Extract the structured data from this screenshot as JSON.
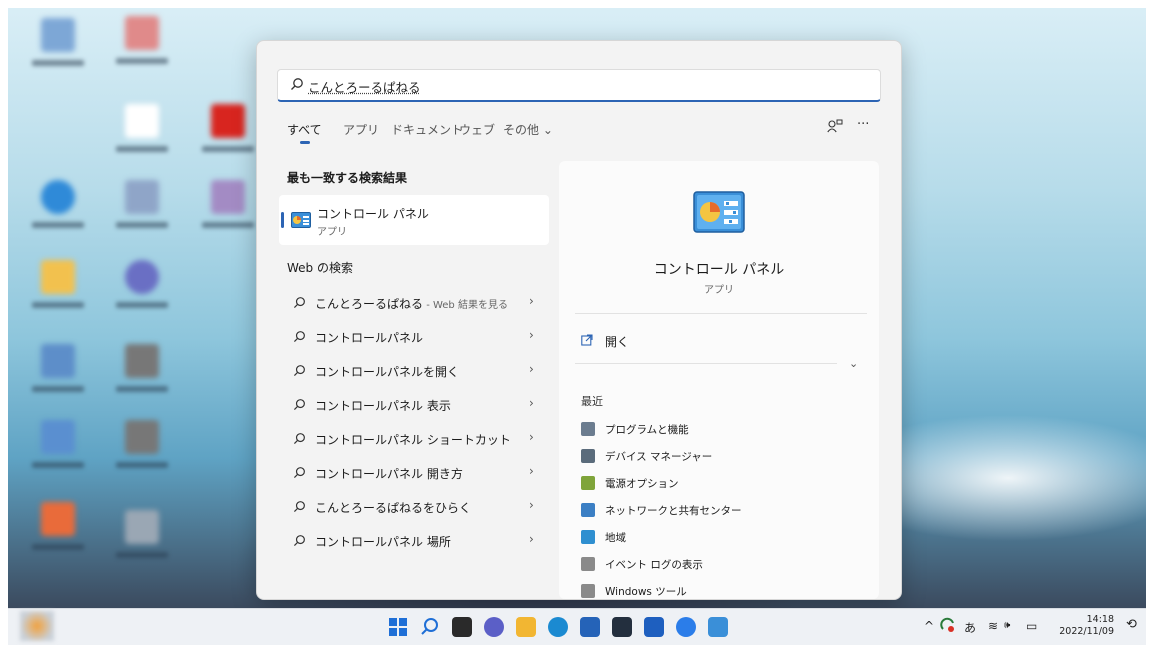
{
  "search": {
    "query": "こんとろーるぱねる"
  },
  "tabs": [
    {
      "label": "すべて"
    },
    {
      "label": "アプリ"
    },
    {
      "label": "ドキュメント"
    },
    {
      "label": "ウェブ"
    },
    {
      "label": "その他 ⌄"
    }
  ],
  "toolbar": {
    "account_icon": "account-icon",
    "more_label": "···"
  },
  "best_match": {
    "title": "最も一致する検索結果",
    "name": "コントロール パネル",
    "type": "アプリ"
  },
  "web": {
    "title": "Web の検索",
    "items": [
      {
        "text": "こんとろーるぱねる",
        "suffix": " - Web 結果を見る"
      },
      {
        "text": "コントロールパネル",
        "suffix": ""
      },
      {
        "text": "コントロールパネルを開く",
        "suffix": ""
      },
      {
        "text": "コントロールパネル 表示",
        "suffix": ""
      },
      {
        "text": "コントロールパネル ショートカット",
        "suffix": ""
      },
      {
        "text": "コントロールパネル 開き方",
        "suffix": ""
      },
      {
        "text": "こんとろーるぱねるをひらく",
        "suffix": ""
      },
      {
        "text": "コントロールパネル 場所",
        "suffix": ""
      }
    ],
    "chevron": "›"
  },
  "detail": {
    "name": "コントロール パネル",
    "type": "アプリ",
    "open_label": "開く",
    "expand_label": "⌄",
    "recent_label": "最近",
    "recent": [
      {
        "label": "プログラムと機能",
        "icon": "programs-icon",
        "color": "#6b7c8f"
      },
      {
        "label": "デバイス マネージャー",
        "icon": "device-manager-icon",
        "color": "#5a6b7b"
      },
      {
        "label": "電源オプション",
        "icon": "power-options-icon",
        "color": "#7fa43a"
      },
      {
        "label": "ネットワークと共有センター",
        "icon": "network-icon",
        "color": "#3b7fc4"
      },
      {
        "label": "地域",
        "icon": "region-icon",
        "color": "#2f8fd0"
      },
      {
        "label": "イベント ログの表示",
        "icon": "event-log-icon",
        "color": "#8a8a8a"
      },
      {
        "label": "Windows ツール",
        "icon": "windows-tools-icon",
        "color": "#8a8a8a"
      }
    ]
  },
  "taskbar": {
    "apps": [
      {
        "name": "start-button",
        "color": "#1f6fd6"
      },
      {
        "name": "search-button",
        "color": "#1f6fd6"
      },
      {
        "name": "task-view-button",
        "color": "#2a2a2a"
      },
      {
        "name": "chat-button",
        "color": "#5b5fc7"
      },
      {
        "name": "file-explorer-button",
        "color": "#f2b632"
      },
      {
        "name": "edge-button",
        "color": "#1b8ad1"
      },
      {
        "name": "store-button",
        "color": "#2563b8"
      },
      {
        "name": "amazon-button",
        "color": "#232f3e"
      },
      {
        "name": "app-blue-button",
        "color": "#1e5fbf"
      },
      {
        "name": "tips-button",
        "color": "#2b7de9"
      },
      {
        "name": "control-panel-button",
        "color": "#3a8fd8"
      }
    ],
    "tray": {
      "chevron": "^",
      "ime": "あ",
      "wifi": "≋",
      "volume": "🕪",
      "battery": "▭"
    },
    "time": "14:18",
    "date": "2022/11/09",
    "notification": "⟲"
  }
}
